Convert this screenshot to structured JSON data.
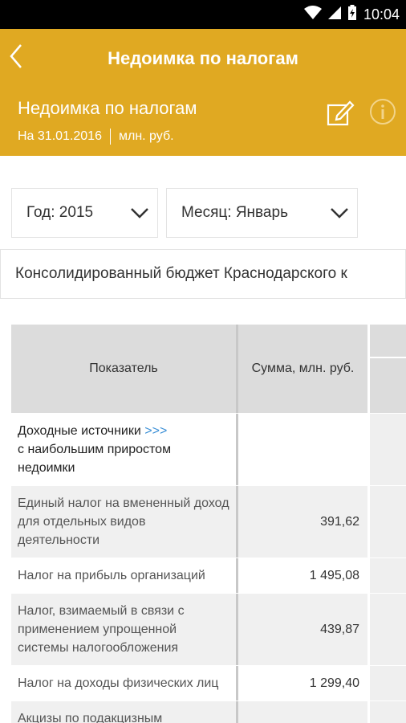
{
  "status_bar": {
    "time": "10:04"
  },
  "appbar": {
    "title": "Недоимка по налогам"
  },
  "header": {
    "title": "Недоимка по налогам",
    "date": "На 31.01.2016",
    "unit": "млн. руб."
  },
  "filters": {
    "year": "Год: 2015",
    "month": "Месяц: Январь",
    "budget": "Консолидированный бюджет Краснодарского к"
  },
  "table": {
    "col_indicator": "Показатель",
    "col_sum": "Сумма, млн. руб.",
    "group": {
      "line1": "Доходные источники",
      "link": ">>>",
      "line2": "с наибольшим приростом недоимки"
    },
    "rows": [
      {
        "name": "Единый налог на вмененный доход для отдельных видов деятельности",
        "sum": "391,62"
      },
      {
        "name": "Налог на прибыль организаций",
        "sum": "1 495,08"
      },
      {
        "name": "Налог, взимаемый в связи с применением упрощенной системы налогообложения",
        "sum": "439,87"
      },
      {
        "name": "Налог на доходы физических лиц",
        "sum": "1 299,40"
      },
      {
        "name": "Акцизы по подакцизным",
        "sum": ""
      }
    ]
  },
  "colors": {
    "accent": "#e0a922",
    "link": "#3a8fd6"
  }
}
